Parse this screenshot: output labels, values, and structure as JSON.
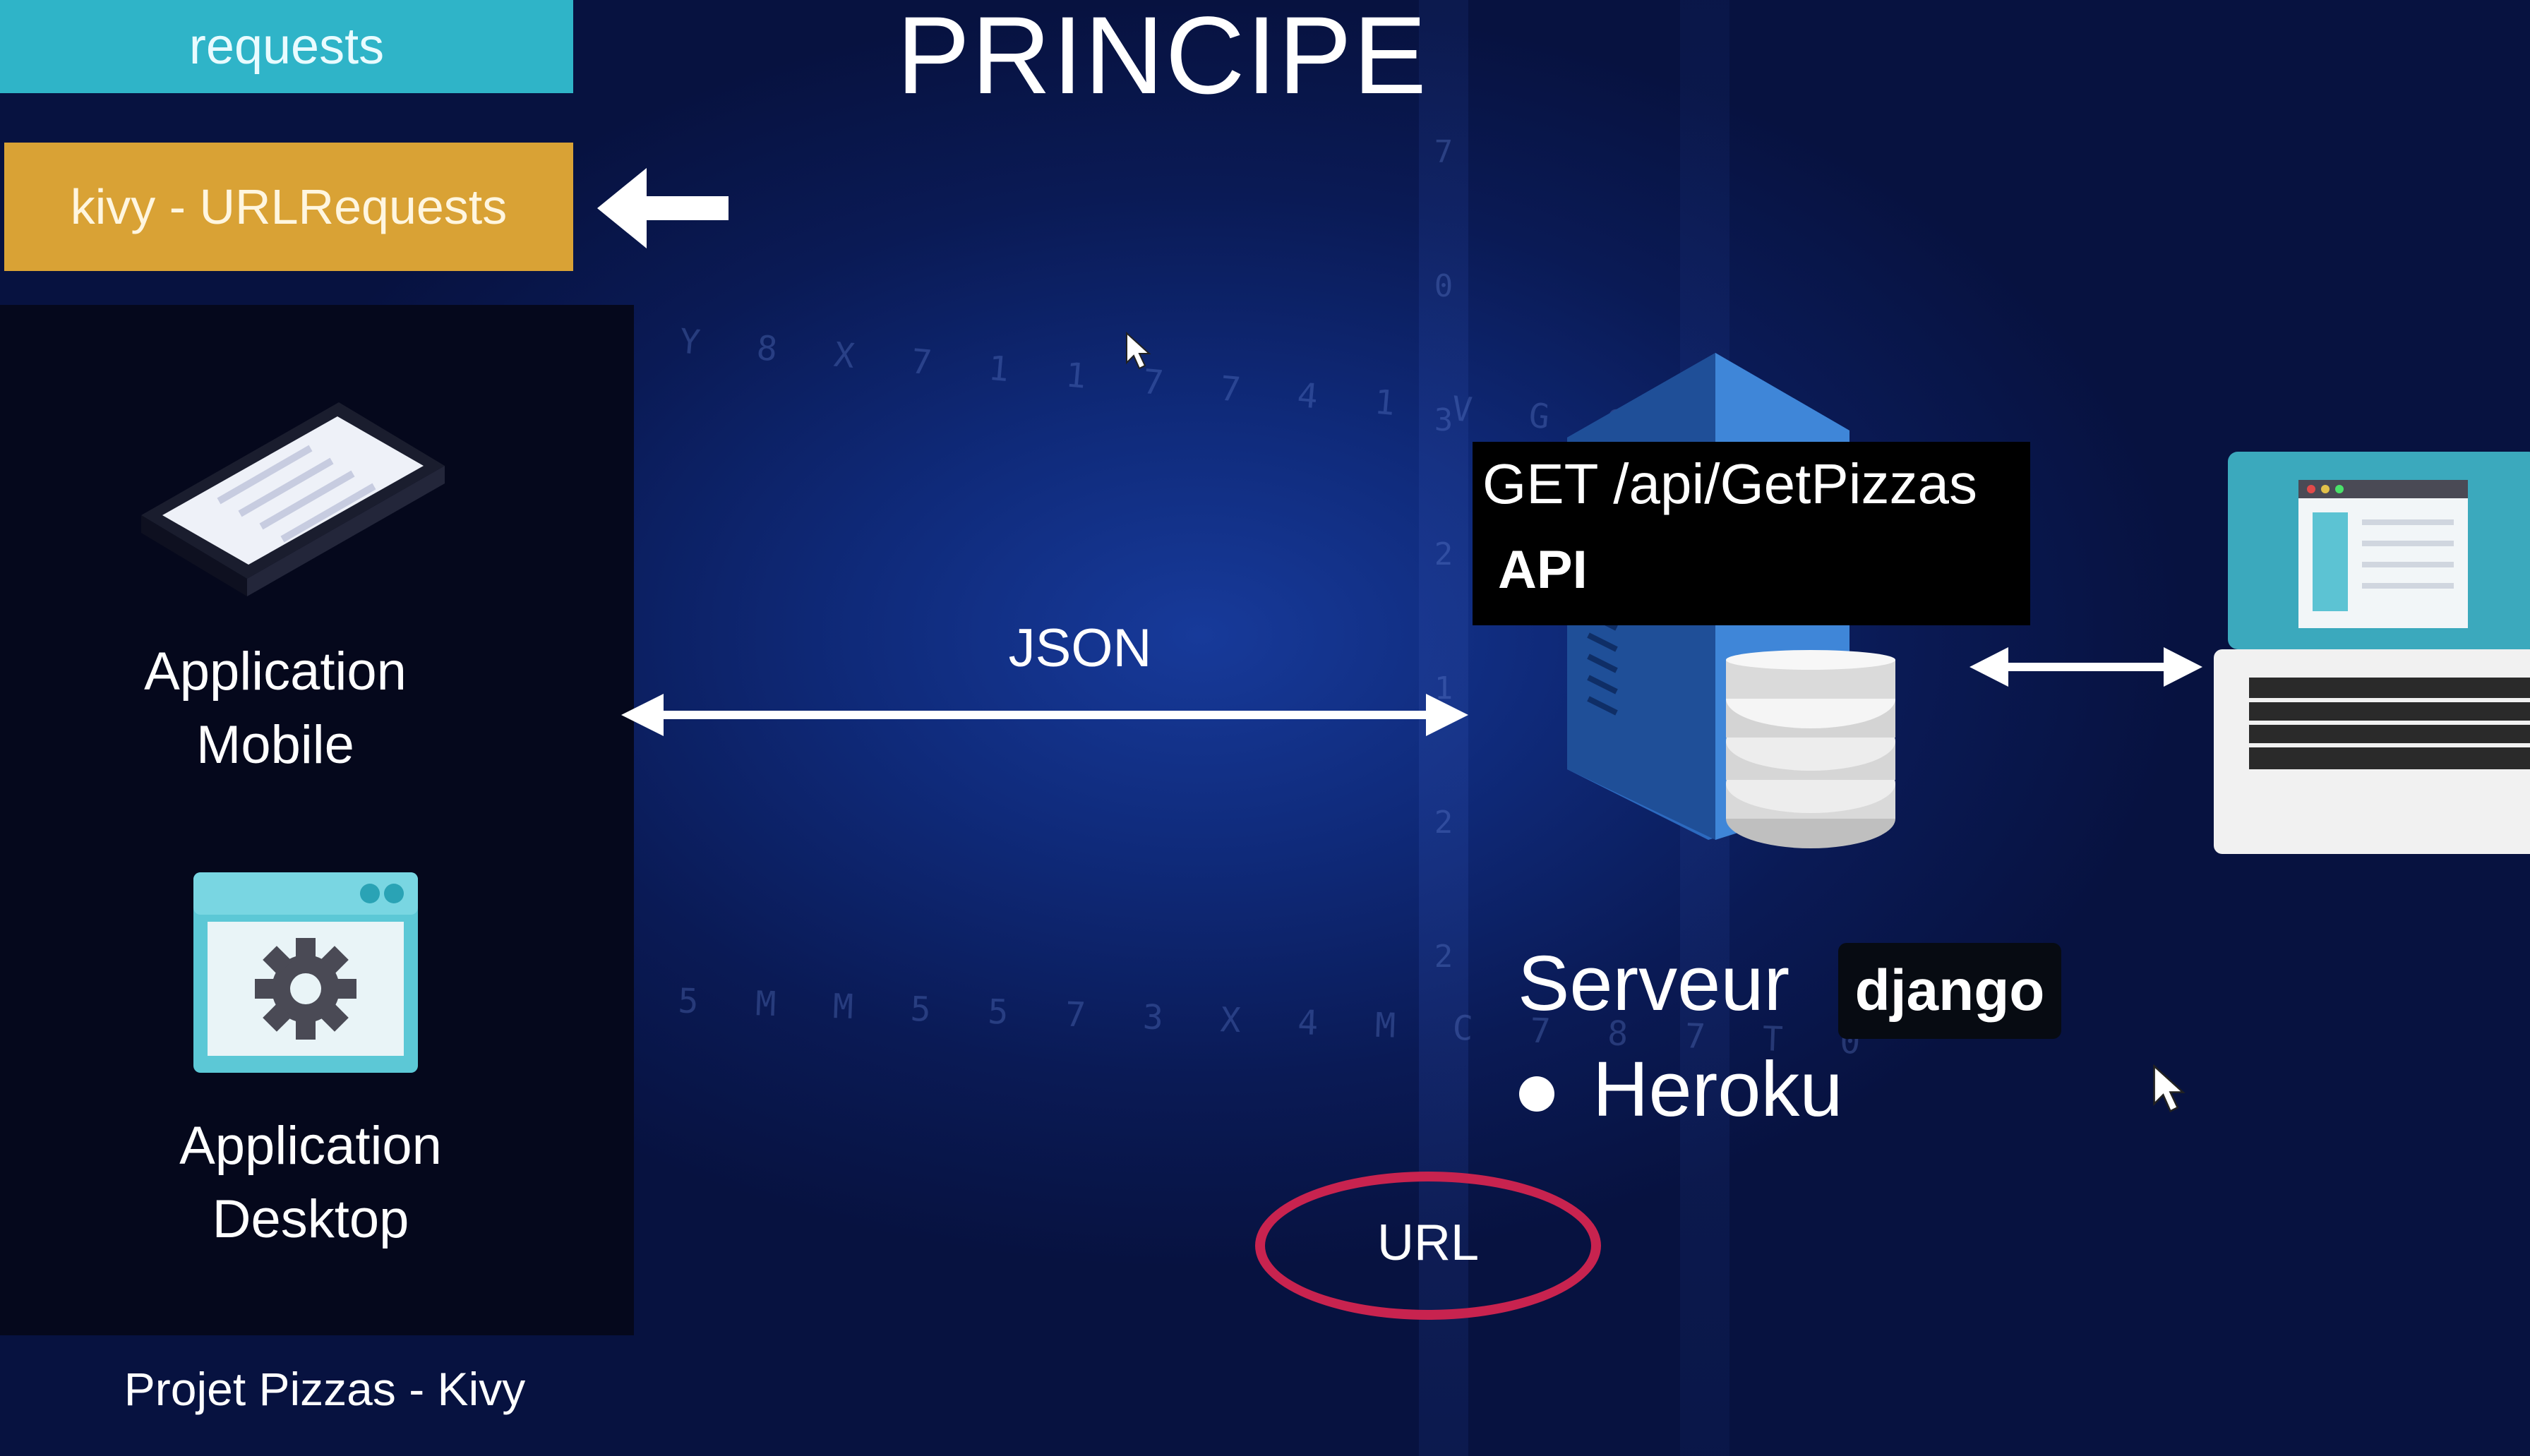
{
  "slide": {
    "title": "PRINCIPE",
    "footer": "Projet Pizzas - Kivy"
  },
  "tags": {
    "requests": "requests",
    "kivy_urlrequests": "kivy - URLRequests"
  },
  "clients": [
    {
      "label_line1": "Application",
      "label_line2": "Mobile",
      "icon": "smartphone-icon"
    },
    {
      "label_line1": "Application",
      "label_line2": "Desktop",
      "icon": "gear-window-icon"
    }
  ],
  "connection": {
    "label": "JSON"
  },
  "api": {
    "endpoint": "GET /api/GetPizzas",
    "label": "API"
  },
  "server": {
    "name": "Serveur",
    "framework": "django",
    "host": "Heroku"
  },
  "url_callout": "URL",
  "colors": {
    "requests_tag": "#2fb4c8",
    "kivy_tag": "#d9a235",
    "url_ellipse": "#c8234f",
    "background": "#0b1a55"
  },
  "background_digits": {
    "row1": "Y 8 X 7 1 1 7 7 4 1 V G 9 Z",
    "row2": "5 M M 5 5 7 3 X 4 M C 7 8 7 T 0",
    "column": [
      "7",
      "0",
      "3",
      "2",
      "1",
      "2",
      "2"
    ]
  }
}
